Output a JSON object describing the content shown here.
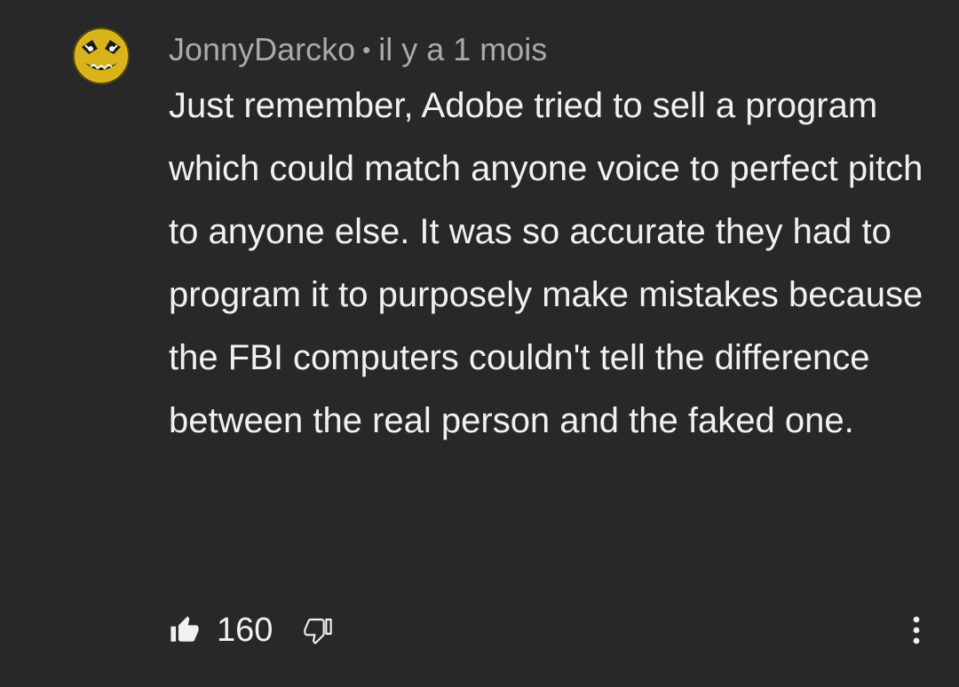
{
  "comment": {
    "author": "JonnyDarcko",
    "separator": "•",
    "timestamp": "il y a 1 mois",
    "text": "Just remember, Adobe tried to sell a program which could match anyone voice to perfect pitch to anyone else. It was so accurate they had to program it to purposely make mistakes because the FBI computers couldn't tell the difference between the real person and the faked one.",
    "like_count": "160"
  },
  "icons": {
    "avatar": "smiley-face-avatar",
    "like": "thumbs-up-icon",
    "dislike": "thumbs-down-icon",
    "more": "more-vert-icon"
  },
  "colors": {
    "background": "#282828",
    "primary_text": "#f1f1f1",
    "secondary_text": "#aaaaaa",
    "avatar_yellow": "#e6c21f"
  }
}
